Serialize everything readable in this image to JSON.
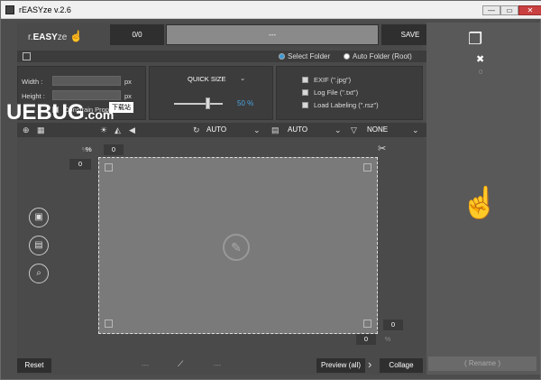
{
  "titlebar": {
    "title": "rEASYze v.2.6",
    "min": "—",
    "max": "▭",
    "close": "✕"
  },
  "header": {
    "logo_prefix": "r.",
    "logo_brand": "EASY",
    "logo_suffix": "ze",
    "counter": "0/0",
    "progress_text": "---",
    "save": "SAVE"
  },
  "source": {
    "select_folder": "Select Folder",
    "auto_folder": "Auto Folder (Root)"
  },
  "size": {
    "width_label": "Width :",
    "height_label": "Height :",
    "width_unit": "px",
    "height_unit": "px",
    "constrain": "Constrain Prop.",
    "width_value": "",
    "height_value": ""
  },
  "quick": {
    "title": "QUICK SIZE",
    "percent": "50 %",
    "level": 0.5
  },
  "options": {
    "exif": "EXIF (\".jpg\")",
    "logfile": "Log File (\".txt\")",
    "labeling": "Load Labeling (\".rsz\")"
  },
  "toolbar": {
    "rotate": "AUTO",
    "format": "AUTO",
    "filter": "NONE"
  },
  "work": {
    "top_pct": "%",
    "top_val": "0",
    "left_val": "0",
    "bottom_val": "0",
    "right_val": "0",
    "bottom_pct": "%",
    "right_pct": "%"
  },
  "footer": {
    "reset": "Reset",
    "dots_left": "---",
    "dots_right": "---",
    "preview": "Preview (all)",
    "collage": "Collage",
    "rename": "( Rename )"
  },
  "right": {
    "count": "0"
  },
  "watermark": {
    "brand": "UEBUG",
    "domain": ".com",
    "badge": "下载站"
  }
}
